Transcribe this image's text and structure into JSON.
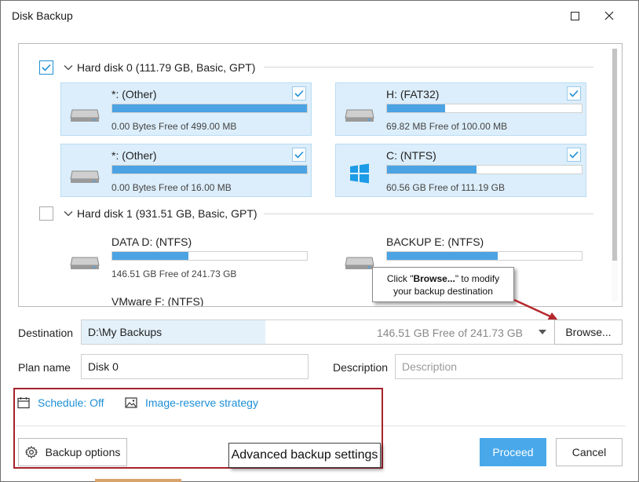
{
  "window": {
    "title": "Disk Backup"
  },
  "disks": [
    {
      "label": "Hard disk 0 (111.79 GB, Basic, GPT)",
      "checked": true,
      "partitions": [
        {
          "name": "*: (Other)",
          "free": "0.00 Bytes Free of 499.00 MB",
          "used_fraction": 1.0,
          "checked": true,
          "icon": "drive-icon"
        },
        {
          "name": "H: (FAT32)",
          "free": "69.82 MB Free of 100.00 MB",
          "used_fraction": 0.3,
          "checked": true,
          "icon": "drive-icon"
        },
        {
          "name": "*: (Other)",
          "free": "0.00 Bytes Free of 16.00 MB",
          "used_fraction": 1.0,
          "checked": true,
          "icon": "drive-icon"
        },
        {
          "name": "C: (NTFS)",
          "free": "60.56 GB Free of 111.19 GB",
          "used_fraction": 0.46,
          "checked": true,
          "icon": "windows-icon"
        }
      ]
    },
    {
      "label": "Hard disk 1 (931.51 GB, Basic, GPT)",
      "checked": false,
      "partitions": [
        {
          "name": "DATA D: (NTFS)",
          "free": "146.51 GB Free of 241.73 GB",
          "used_fraction": 0.39,
          "checked": false,
          "icon": "drive-icon"
        },
        {
          "name": "BACKUP E: (NTFS)",
          "free": "",
          "used_fraction": 0.57,
          "checked": false,
          "icon": "drive-icon"
        },
        {
          "name": "VMware F: (NTFS)",
          "free": "",
          "used_fraction": 0,
          "checked": false,
          "icon": "drive-icon"
        }
      ]
    }
  ],
  "callout": {
    "prefix": "Click \"",
    "bold": "Browse...",
    "suffix": "\" to modify",
    "line2": "your backup destination"
  },
  "destination": {
    "label": "Destination",
    "path": "D:\\My Backups",
    "free": "146.51 GB Free of 241.73 GB",
    "browse_label": "Browse..."
  },
  "plan": {
    "label": "Plan name",
    "value": "Disk 0"
  },
  "description": {
    "label": "Description",
    "placeholder": "Description"
  },
  "schedule": {
    "label": "Schedule: Off"
  },
  "image_reserve": {
    "label": "Image-reserve strategy"
  },
  "backup_options": {
    "label": "Backup options"
  },
  "advanced_note": {
    "label": "Advanced backup settings"
  },
  "buttons": {
    "proceed": "Proceed",
    "cancel": "Cancel"
  },
  "colors": {
    "accent": "#49a8ea",
    "bar": "#4ba3e3",
    "selected_bg": "#dceefb",
    "annotation_red": "#a5232b"
  }
}
